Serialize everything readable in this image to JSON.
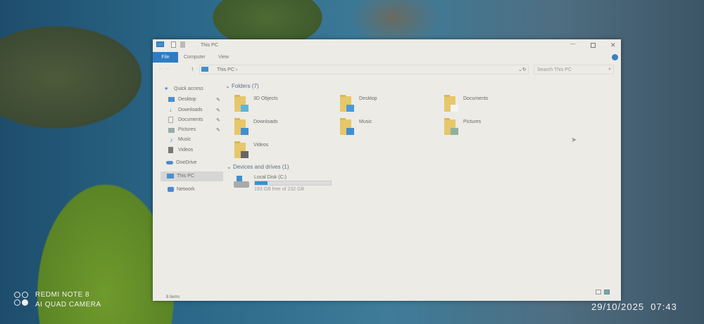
{
  "window": {
    "title": "This PC",
    "tabs": [
      "File",
      "Computer",
      "View"
    ],
    "controls": [
      "minimize",
      "maximize",
      "close"
    ]
  },
  "address": {
    "path": "This PC",
    "separator": "›",
    "search_placeholder": "Search This PC"
  },
  "nav": {
    "quick_access": "Quick access",
    "items": [
      {
        "label": "Desktop",
        "pinned": true
      },
      {
        "label": "Downloads",
        "pinned": true
      },
      {
        "label": "Documents",
        "pinned": true
      },
      {
        "label": "Pictures",
        "pinned": true
      },
      {
        "label": "Music",
        "pinned": false
      },
      {
        "label": "Videos",
        "pinned": false
      }
    ],
    "onedrive": "OneDrive",
    "this_pc": "This PC",
    "network": "Network"
  },
  "folders": {
    "header": "Folders (7)",
    "items": [
      "3D Objects",
      "Desktop",
      "Documents",
      "Downloads",
      "Music",
      "Pictures",
      "Videos"
    ]
  },
  "devices": {
    "header": "Devices and drives (1)",
    "drive": {
      "name": "Local Disk (C:)",
      "free_text": "193 GB free of 232 GB",
      "used_fraction": 0.17
    }
  },
  "status": {
    "items": "8 items"
  },
  "watermark": {
    "line1": "REDMI NOTE 8",
    "line2": "AI QUAD CAMERA"
  },
  "timestamp": "29/10/2025  07:43",
  "colors": {
    "accent": "#2f7cc4",
    "folder": "#e7c76a",
    "selection": "#d6d6d4"
  }
}
